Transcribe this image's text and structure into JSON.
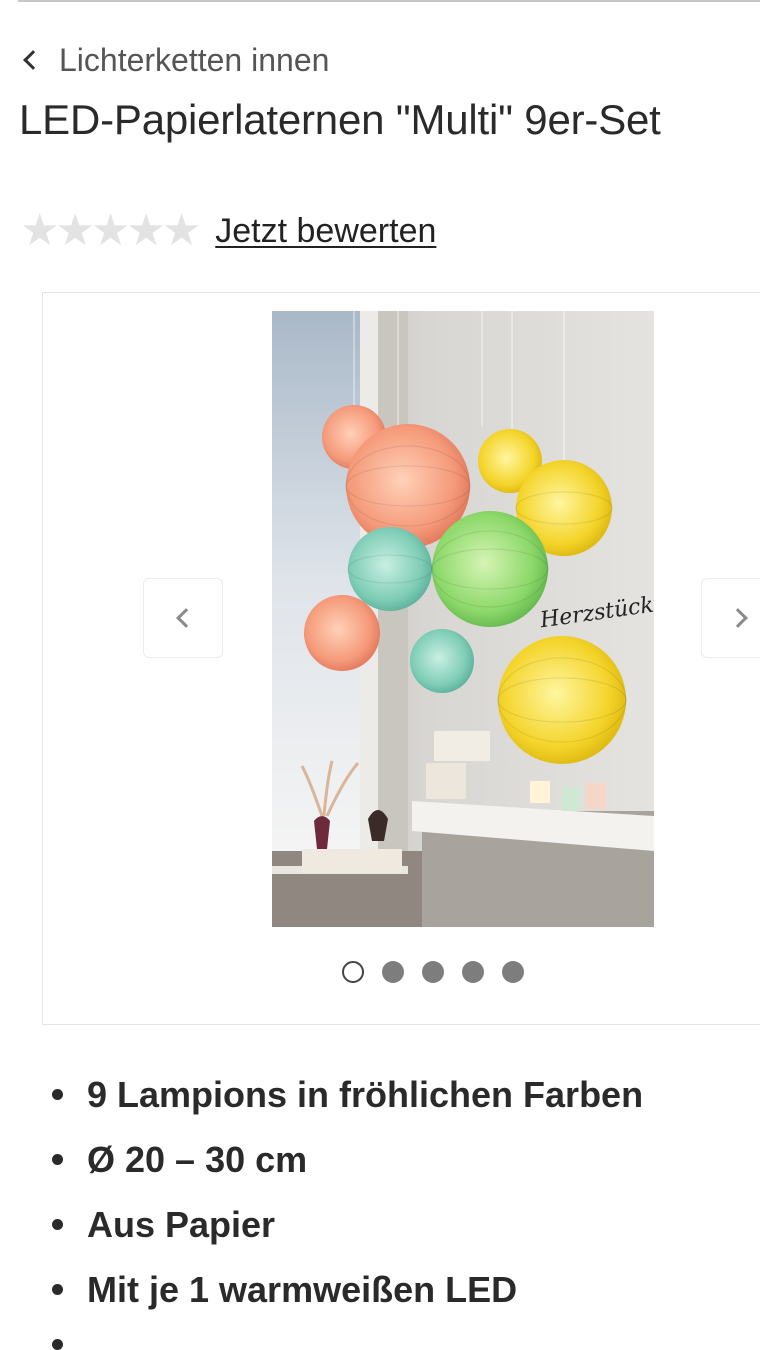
{
  "breadcrumb": {
    "label": "Lichterketten innen"
  },
  "product": {
    "title": "LED-Papierlaternen \"Multi\" 9er-Set"
  },
  "rating": {
    "stars_filled": 0,
    "stars_total": 5,
    "link": "Jetzt bewerten"
  },
  "gallery": {
    "image_signature": "Herzstück",
    "slide_count": 5,
    "active_slide": 1
  },
  "features": [
    "9 Lampions in fröhlichen Farben",
    "Ø 20 – 30 cm",
    "Aus Papier",
    "Mit je 1 warmweißen LED"
  ],
  "colors": {
    "text": "#222222",
    "star_empty": "#e3e3e3",
    "dot": "#7d7d7d",
    "border": "#e4e4e4"
  }
}
